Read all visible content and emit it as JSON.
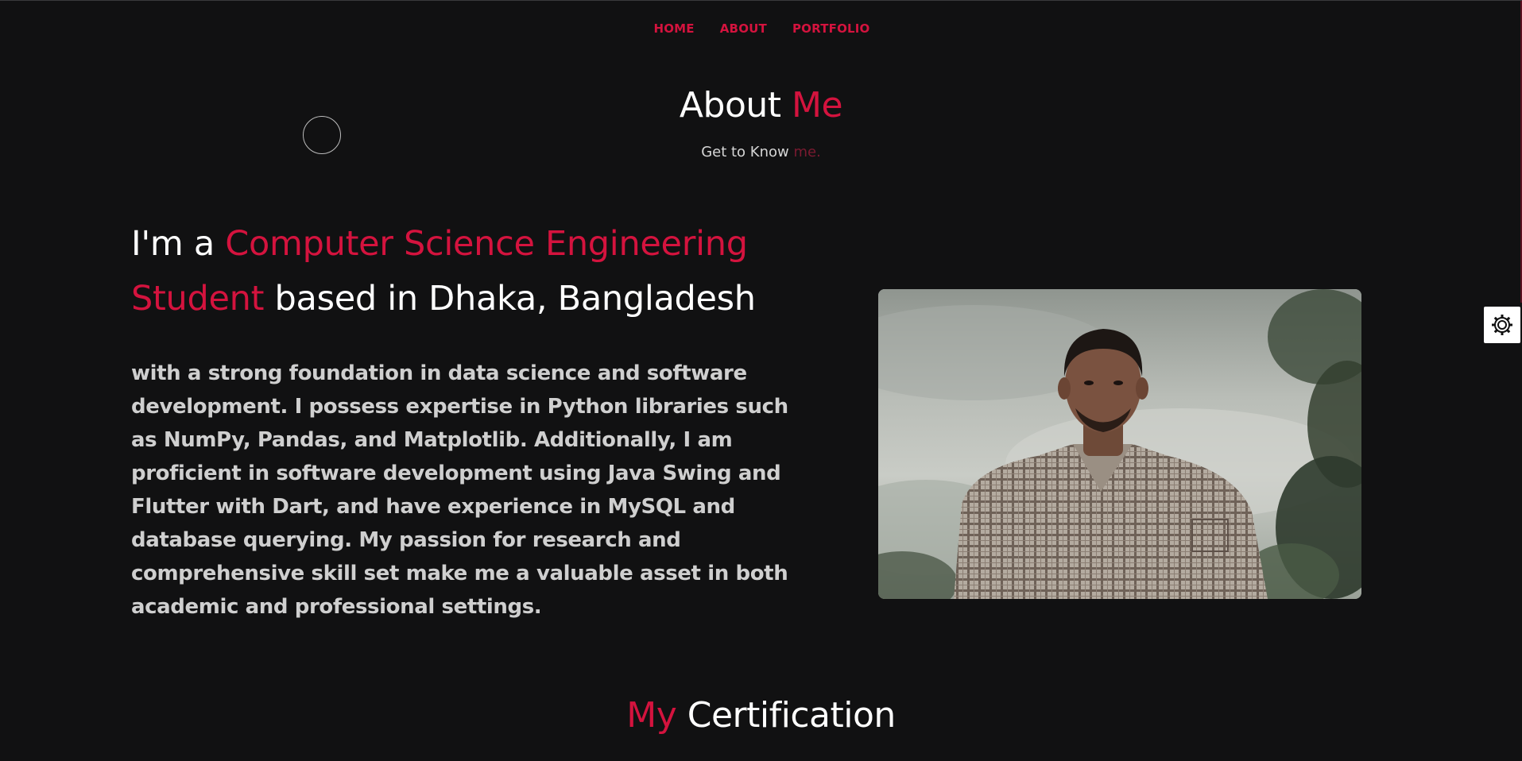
{
  "nav": {
    "items": [
      {
        "label": "HOME"
      },
      {
        "label": "ABOUT"
      },
      {
        "label": "PORTFOLIO"
      }
    ]
  },
  "about": {
    "title_part1": "About",
    "title_part2": "Me",
    "subtitle_part1": "Get to Know",
    "subtitle_part2": "me."
  },
  "intro": {
    "prefix": "I'm a",
    "highlight": "Computer Science Engineering Student",
    "suffix": "based in Dhaka, Bangladesh",
    "bio": "with a strong foundation in data science and software development. I possess expertise in Python libraries such as NumPy, Pandas, and Matplotlib. Additionally, I am proficient in software development using Java Swing and Flutter with Dart, and have experience in MySQL and database querying. My passion for research and comprehensive skill set make me a valuable asset in both academic and professional settings."
  },
  "certification": {
    "title_part1": "My",
    "title_part2": "Certification"
  },
  "theme": {
    "accent": "#d4133e",
    "background": "#111112",
    "text": "#ffffff"
  },
  "icons": {
    "settings": "gear-icon"
  }
}
